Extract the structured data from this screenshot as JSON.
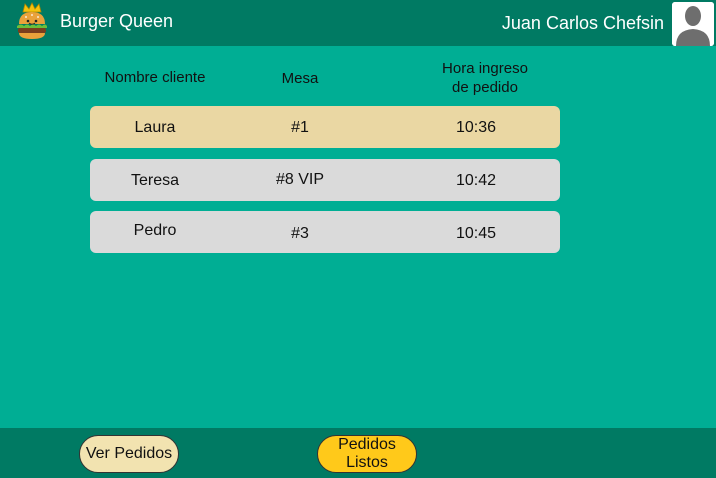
{
  "header": {
    "brand": "Burger Queen",
    "user_name": "Juan Carlos Chefsin",
    "logo_icon": "burger-queen-logo-icon",
    "avatar_icon": "user-silhouette-icon"
  },
  "table": {
    "columns": {
      "name": "Nombre cliente",
      "table": "Mesa",
      "time_line1": "Hora ingreso",
      "time_line2": "de pedido"
    },
    "rows": [
      {
        "name": "Laura",
        "table": "#1",
        "time": "10:36",
        "selected": true
      },
      {
        "name": "Teresa",
        "table": "#8 VIP",
        "time": "10:42",
        "selected": false
      },
      {
        "name": "Pedro",
        "table": "#3",
        "time": "10:45",
        "selected": false
      }
    ]
  },
  "footer": {
    "view_orders": "Ver Pedidos",
    "ready_line1": "Pedidos",
    "ready_line2": "Listos"
  },
  "colors": {
    "background": "#00AE94",
    "bars": "#007A63",
    "row": "#DADADA",
    "row_selected": "#EAD7A3",
    "button_orders": "#F2E3B0",
    "button_ready": "#FFC91A"
  }
}
